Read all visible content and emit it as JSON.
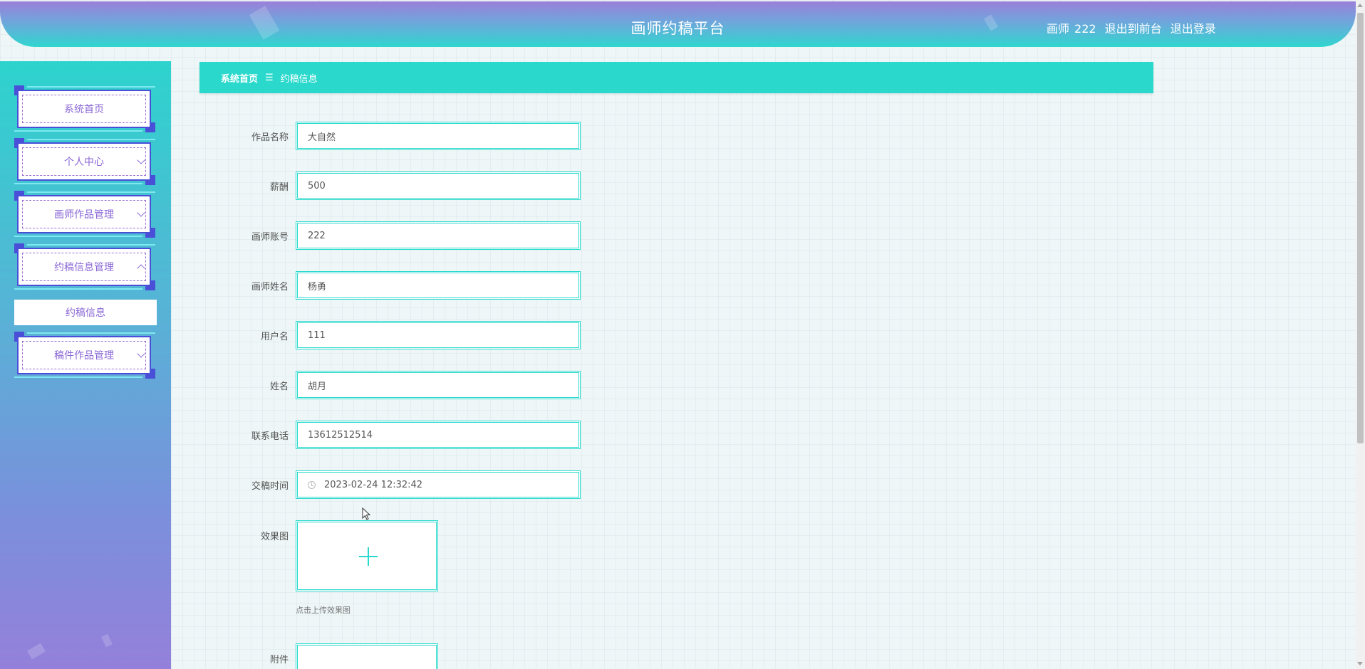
{
  "header": {
    "title": "画师约稿平台",
    "user_prefix": "画师",
    "username": "222",
    "back_to_front": "退出到前台",
    "logout": "退出登录"
  },
  "sidebar": {
    "items": [
      {
        "label": "系统首页",
        "has_chevron": false
      },
      {
        "label": "个人中心",
        "has_chevron": true
      },
      {
        "label": "画师作品管理",
        "has_chevron": true
      },
      {
        "label": "约稿信息管理",
        "has_chevron": true,
        "expanded": true
      },
      {
        "label": "稿件作品管理",
        "has_chevron": true
      }
    ],
    "submenu": {
      "label": "约稿信息"
    }
  },
  "breadcrumb": {
    "home": "系统首页",
    "separator": "☰",
    "current": "约稿信息"
  },
  "form": {
    "fields": [
      {
        "label": "作品名称",
        "value": "大自然"
      },
      {
        "label": "薪酬",
        "value": "500"
      },
      {
        "label": "画师账号",
        "value": "222"
      },
      {
        "label": "画师姓名",
        "value": "杨勇"
      },
      {
        "label": "用户名",
        "value": "111"
      },
      {
        "label": "姓名",
        "value": "胡月"
      },
      {
        "label": "联系电话",
        "value": "13612512514"
      },
      {
        "label": "交稿时间",
        "value": "2023-02-24 12:32:42"
      }
    ],
    "effect_image": {
      "label": "效果图",
      "hint": "点击上传效果图"
    },
    "attachment": {
      "label": "附件"
    }
  },
  "colors": {
    "accent": "#2ad9cc",
    "menu_text": "#8a67d6",
    "menu_border": "#4a4fd8"
  }
}
